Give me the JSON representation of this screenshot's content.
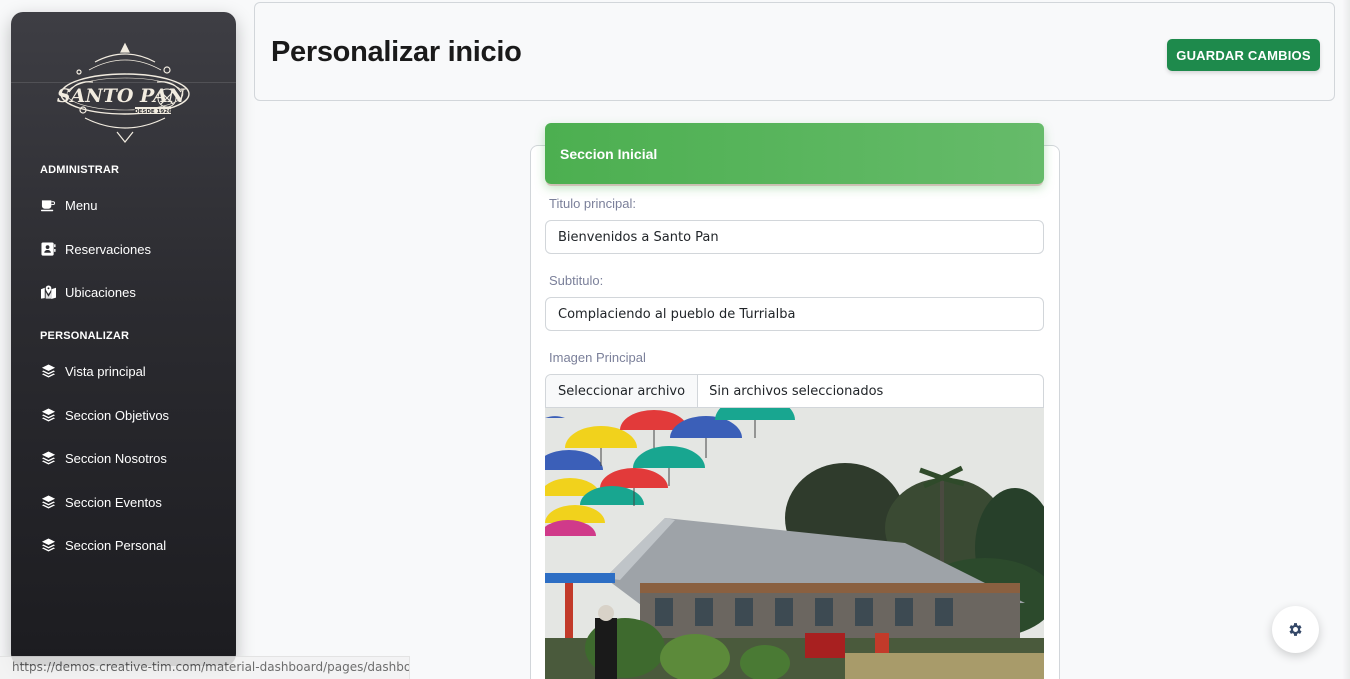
{
  "brand": {
    "logo_text": "SANTO PAN",
    "logo_tagline": "DESDE 1926"
  },
  "sidebar": {
    "sections": [
      {
        "heading": "ADMINISTRAR",
        "items": [
          {
            "label": "Menu",
            "icon": "coffee-cup-icon"
          },
          {
            "label": "Reservaciones",
            "icon": "contact-card-icon"
          },
          {
            "label": "Ubicaciones",
            "icon": "map-pin-icon"
          }
        ]
      },
      {
        "heading": "PERSONALIZAR",
        "items": [
          {
            "label": "Vista principal",
            "icon": "layers-icon"
          },
          {
            "label": "Seccion Objetivos",
            "icon": "layers-icon"
          },
          {
            "label": "Seccion Nosotros",
            "icon": "layers-icon"
          },
          {
            "label": "Seccion Eventos",
            "icon": "layers-icon"
          },
          {
            "label": "Seccion Personal",
            "icon": "layers-icon"
          }
        ]
      }
    ]
  },
  "header": {
    "title": "Personalizar inicio",
    "save_label": "GUARDAR CAMBIOS"
  },
  "form": {
    "section_title": "Seccion Inicial",
    "fields": {
      "titulo": {
        "label": "Titulo principal:",
        "value": "Bienvenidos a Santo Pan"
      },
      "subtitulo": {
        "label": "Subtitulo:",
        "value": "Complaciendo al pueblo de Turrialba"
      },
      "imagen": {
        "label": "Imagen Principal",
        "button": "Seleccionar archivo",
        "status": "Sin archivos seleccionados"
      }
    }
  },
  "status_bar": {
    "url": "https://demos.creative-tim.com/material-dashboard/pages/dashboard"
  },
  "colors": {
    "accent_green": "#4caf50",
    "save_button": "#1e8a4c",
    "sidebar_dark": "#2b2b30"
  },
  "fab": {
    "icon": "gear-icon"
  }
}
